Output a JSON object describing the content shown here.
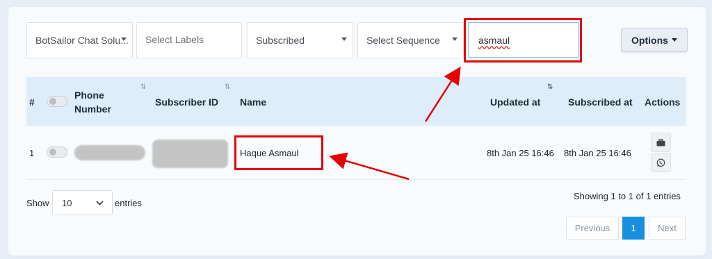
{
  "filters": {
    "inbox": "BotSailor Chat Solu...",
    "labels_placeholder": "Select Labels",
    "status": "Subscribed",
    "sequence": "Select Sequence",
    "search_value": "asmaul"
  },
  "options_label": "Options",
  "table": {
    "headers": {
      "num": "#",
      "phone_line1": "Phone",
      "phone_line2": "Number",
      "subscriber_id": "Subscriber ID",
      "name": "Name",
      "updated": "Updated at",
      "subscribed": "Subscribed at",
      "actions": "Actions"
    },
    "rows": [
      {
        "num": "1",
        "name": "Haque Asmaul",
        "updated": "8th Jan 25 16:46",
        "subscribed": "8th Jan 25 16:46"
      }
    ]
  },
  "footer": {
    "show": "Show",
    "length_value": "10",
    "entries": "entries",
    "info": "Showing 1 to 1 of 1 entries",
    "prev": "Previous",
    "page": "1",
    "next": "Next"
  },
  "colors": {
    "highlight": "#e60000",
    "accent": "#1a8fe0"
  },
  "icons": {
    "sort": "sort-icon",
    "briefcase": "briefcase-icon",
    "whatsapp": "whatsapp-icon"
  }
}
